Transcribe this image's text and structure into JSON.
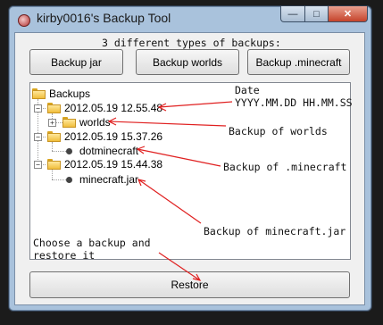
{
  "window": {
    "title": "kirby0016's Backup Tool"
  },
  "top_buttons": {
    "jar": "Backup jar",
    "worlds": "Backup worlds",
    "minecraft": "Backup .minecraft"
  },
  "tree": {
    "root": "Backups",
    "backups": [
      {
        "label": "2012.05.19 12.55.48",
        "child": "worlds"
      },
      {
        "label": "2012.05.19 15.37.26",
        "child": "dotminecraft"
      },
      {
        "label": "2012.05.19 15.44.38",
        "child": "minecraft.jar"
      }
    ]
  },
  "restore_button": "Restore",
  "annotations": {
    "types": "3 different types of backups:",
    "date": "Date\nYYYY.MM.DD HH.MM.SS",
    "worlds": "Backup of worlds",
    "minecraft": "Backup of .minecraft",
    "jar": "Backup of minecraft.jar",
    "restore": "Choose a backup and\nrestore it"
  },
  "colors": {
    "annotation_arrow": "#e02020",
    "title_bar": "#a9c2dc"
  }
}
